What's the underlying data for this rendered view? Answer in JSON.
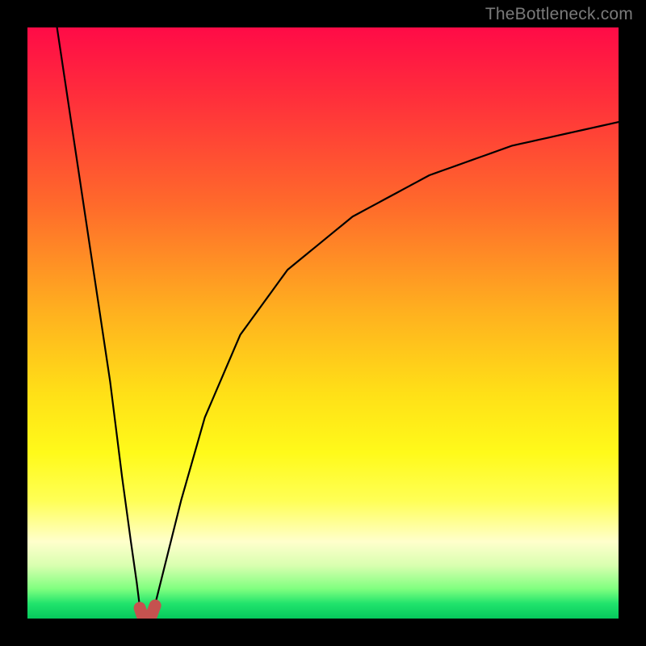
{
  "attribution": "TheBottleneck.com",
  "colors": {
    "frame": "#000000",
    "curve": "#000000",
    "marker": "#c5524f",
    "gradient_top": "#ff0b47",
    "gradient_bottom": "#06c95c"
  },
  "chart_data": {
    "type": "line",
    "title": "",
    "xlabel": "",
    "ylabel": "",
    "xlim": [
      0,
      100
    ],
    "ylim": [
      0,
      100
    ],
    "grid": false,
    "legend": false,
    "annotations": [
      "TheBottleneck.com"
    ],
    "series": [
      {
        "name": "left-branch",
        "x": [
          5,
          8,
          11,
          14,
          16,
          17.5,
          18.5,
          19,
          19.25,
          19.5
        ],
        "y": [
          100,
          80,
          60,
          40,
          24,
          13,
          6,
          2,
          0.8,
          0
        ]
      },
      {
        "name": "right-branch",
        "x": [
          21,
          21.5,
          23,
          26,
          30,
          36,
          44,
          55,
          68,
          82,
          100
        ],
        "y": [
          0,
          2,
          8,
          20,
          34,
          48,
          59,
          68,
          75,
          80,
          84
        ]
      }
    ],
    "markers": [
      {
        "name": "valley-marker",
        "shape": "u",
        "color": "#c5524f",
        "points": [
          {
            "x": 19.0,
            "y": 1.8
          },
          {
            "x": 19.4,
            "y": 0.6
          },
          {
            "x": 20.2,
            "y": 0.1
          },
          {
            "x": 21.0,
            "y": 0.6
          },
          {
            "x": 21.6,
            "y": 2.2
          }
        ]
      }
    ]
  }
}
